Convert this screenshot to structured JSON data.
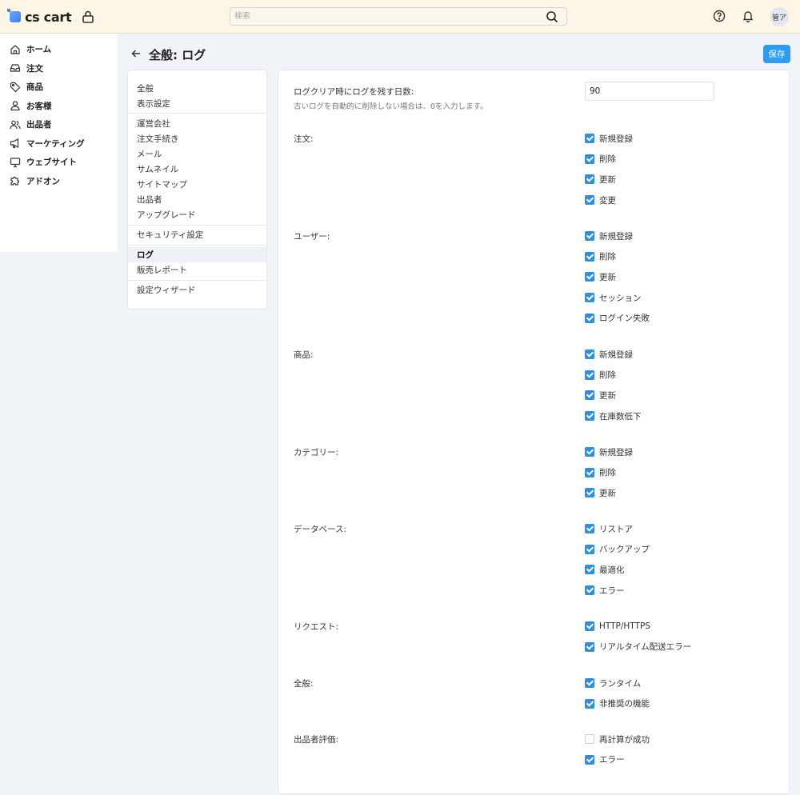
{
  "topbar": {
    "logo": "cs cart",
    "search_placeholder": "検索",
    "avatar": "管ア"
  },
  "sidenav": {
    "items": [
      {
        "label": "ホーム",
        "icon": "home-icon"
      },
      {
        "label": "注文",
        "icon": "inbox-icon"
      },
      {
        "label": "商品",
        "icon": "tag-icon"
      },
      {
        "label": "お客様",
        "icon": "user-icon"
      },
      {
        "label": "出品者",
        "icon": "users-icon"
      },
      {
        "label": "マーケティング",
        "icon": "megaphone-icon"
      },
      {
        "label": "ウェブサイト",
        "icon": "monitor-icon"
      },
      {
        "label": "アドオン",
        "icon": "puzzle-icon"
      }
    ]
  },
  "header": {
    "title": "全般: ログ",
    "save_label": "保存"
  },
  "submenu": {
    "items": [
      "全般",
      "表示設定",
      "運営会社",
      "注文手続き",
      "メール",
      "サムネイル",
      "サイトマップ",
      "出品者",
      "アップグレード",
      "セキュリティ設定",
      "ログ",
      "販売レポート",
      "設定ウィザード"
    ],
    "active": "ログ"
  },
  "settings": {
    "log_days_label": "ログクリア時にログを残す日数:",
    "log_days_hint": "古いログを自動的に削除しない場合は、0を入力します。",
    "log_days_value": "90",
    "groups": [
      {
        "label": "注文:",
        "options": [
          {
            "label": "新規登録",
            "checked": true
          },
          {
            "label": "削除",
            "checked": true
          },
          {
            "label": "更新",
            "checked": true
          },
          {
            "label": "変更",
            "checked": true
          }
        ]
      },
      {
        "label": "ユーザー:",
        "options": [
          {
            "label": "新規登録",
            "checked": true
          },
          {
            "label": "削除",
            "checked": true
          },
          {
            "label": "更新",
            "checked": true
          },
          {
            "label": "セッション",
            "checked": true
          },
          {
            "label": "ログイン失敗",
            "checked": true
          }
        ]
      },
      {
        "label": "商品:",
        "options": [
          {
            "label": "新規登録",
            "checked": true
          },
          {
            "label": "削除",
            "checked": true
          },
          {
            "label": "更新",
            "checked": true
          },
          {
            "label": "在庫数低下",
            "checked": true
          }
        ]
      },
      {
        "label": "カテゴリー:",
        "options": [
          {
            "label": "新規登録",
            "checked": true
          },
          {
            "label": "削除",
            "checked": true
          },
          {
            "label": "更新",
            "checked": true
          }
        ]
      },
      {
        "label": "データベース:",
        "options": [
          {
            "label": "リストア",
            "checked": true
          },
          {
            "label": "バックアップ",
            "checked": true
          },
          {
            "label": "最適化",
            "checked": true
          },
          {
            "label": "エラー",
            "checked": true
          }
        ]
      },
      {
        "label": "リクエスト:",
        "options": [
          {
            "label": "HTTP/HTTPS",
            "checked": true
          },
          {
            "label": "リアルタイム配送エラー",
            "checked": true
          }
        ]
      },
      {
        "label": "全般:",
        "options": [
          {
            "label": "ランタイム",
            "checked": true
          },
          {
            "label": "非推奨の機能",
            "checked": true
          }
        ]
      },
      {
        "label": "出品者評価:",
        "options": [
          {
            "label": "再計算が成功",
            "checked": false
          },
          {
            "label": "エラー",
            "checked": true
          }
        ]
      }
    ]
  },
  "colors": {
    "accent": "#2e9cf2",
    "checkbox": "#2e8fe0",
    "topbar_bg": "#fdf6e6"
  }
}
